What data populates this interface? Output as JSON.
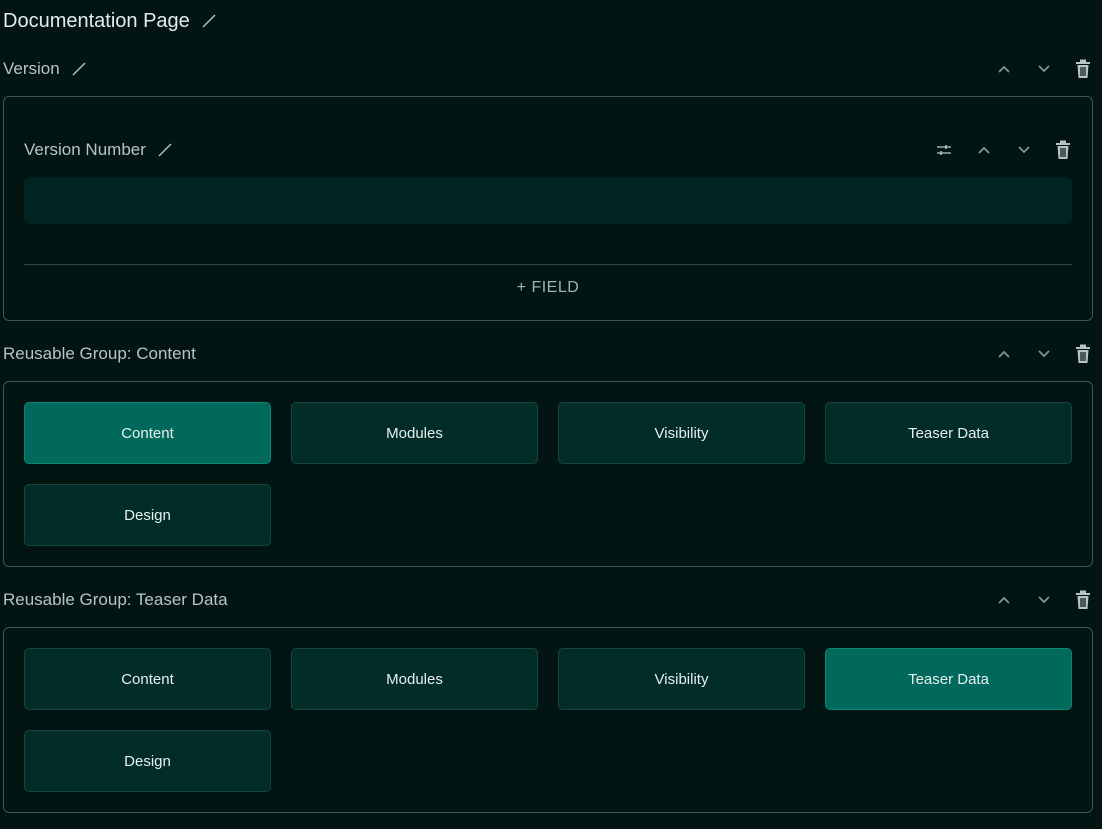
{
  "page": {
    "title": "Documentation Page"
  },
  "version_section": {
    "title": "Version",
    "field": {
      "label": "Version Number",
      "value": "",
      "placeholder": ""
    },
    "add_field_label": "+ FIELD"
  },
  "content_group": {
    "title": "Reusable Group: Content",
    "active_tab": "Content",
    "tabs": [
      "Content",
      "Modules",
      "Visibility",
      "Teaser Data",
      "Design"
    ]
  },
  "teaser_group": {
    "title": "Reusable Group: Teaser Data",
    "active_tab": "Teaser Data",
    "tabs": [
      "Content",
      "Modules",
      "Visibility",
      "Teaser Data",
      "Design"
    ]
  },
  "icons": {
    "edit": "pencil-icon",
    "settings": "sliders-icon",
    "up": "chevron-up-icon",
    "down": "chevron-down-icon",
    "delete": "trash-icon"
  },
  "colors": {
    "background": "#031513",
    "panel_border": "#3f5654",
    "tab_bg": "#012c28",
    "tab_active_bg": "#00695c",
    "input_bg": "#002421",
    "text_primary": "#e3eceb",
    "text_muted": "#9fb3b0"
  }
}
